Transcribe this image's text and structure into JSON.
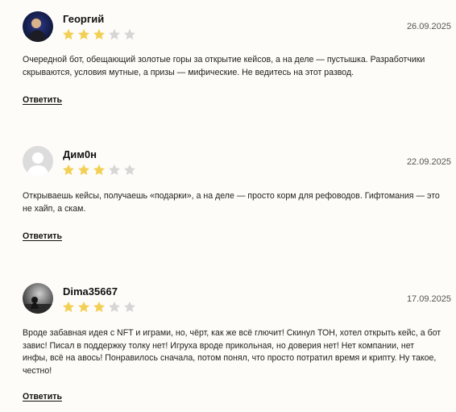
{
  "reviews": [
    {
      "author": "Георгий",
      "date": "26.09.2025",
      "rating": 3,
      "rating_max": 5,
      "text": "Очередной бот, обещающий золотые горы за открытие кейсов, а на деле — пустышка. Разработчики скрываются, условия мутные, а призы — мифические. Не ведитесь на этот развод.",
      "reply_label": "Ответить"
    },
    {
      "author": "Дим0н",
      "date": "22.09.2025",
      "rating": 3,
      "rating_max": 5,
      "text": "Открываешь кейсы, получаешь «подарки», а на деле — просто корм для рефоводов. Гифтомания — это не хайп, а скам.",
      "reply_label": "Ответить"
    },
    {
      "author": "Dima35667",
      "date": "17.09.2025",
      "rating": 3,
      "rating_max": 5,
      "text": "Вроде забавная идея с NFT и играми, но, чёрт, как же всё глючит! Скинул ТОН, хотел открыть кейс, а бот завис! Писал в поддержку толку нет! Игруха вроде прикольная, но доверия нет! Нет компании, нет инфы, всё на авось! Понравилось сначала, потом понял, что просто потратил время и крипту. Ну такое, честно!",
      "reply_label": "Ответить"
    }
  ],
  "colors": {
    "star_filled": "#f2cf55",
    "star_empty": "#d6d6d6",
    "background": "#fefcf8"
  },
  "icons": {
    "star": "star-icon"
  }
}
